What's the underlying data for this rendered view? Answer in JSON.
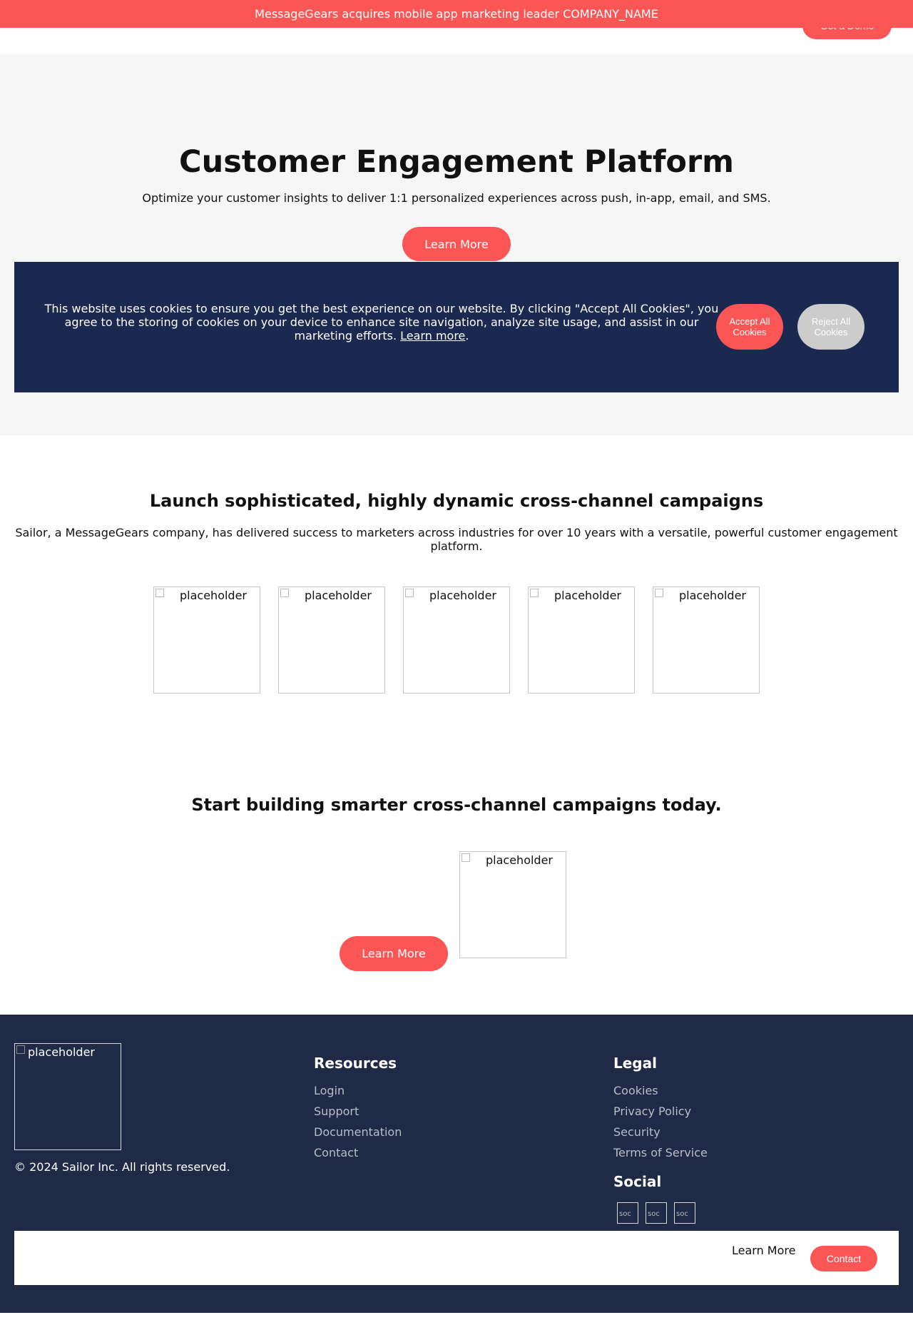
{
  "announcement": {
    "text": "MessageGears acquires mobile app marketing leader COMPANY_NAME"
  },
  "header": {
    "demo_button": "Get a Demo"
  },
  "hero": {
    "title": "Customer Engagement Platform",
    "subtitle": "Optimize your customer insights to deliver 1:1 personalized experiences across push, in-app, email, and SMS.",
    "cta": "Learn More"
  },
  "cookie_banner": {
    "text": "This website uses cookies to ensure you get the best experience on our website. By clicking \"Accept All Cookies\", you agree to the storing of cookies on your device to enhance site navigation, analyze site usage, and assist in our marketing efforts.",
    "link": "Learn more",
    "accept": "Accept All Cookies",
    "reject": "Reject All Cookies"
  },
  "campaigns": {
    "title": "Launch sophisticated, highly dynamic cross-channel campaigns",
    "subtitle": "Sailor, a MessageGears company, has delivered success to marketers across industries for over 10 years with a versatile, powerful customer engagement platform.",
    "logos": [
      "placeholder",
      "placeholder",
      "placeholder",
      "placeholder",
      "placeholder"
    ]
  },
  "cta_section": {
    "title": "Start building smarter cross-channel campaigns today.",
    "button": "Learn More",
    "image_alt": "placeholder"
  },
  "footer": {
    "logo_alt": "placeholder",
    "copyright": "© 2024 Sailor Inc. All rights reserved.",
    "resources": {
      "heading": "Resources",
      "links": [
        "Login",
        "Support",
        "Documentation",
        "Contact"
      ]
    },
    "legal": {
      "heading": "Legal",
      "links": [
        "Cookies",
        "Privacy Policy",
        "Security",
        "Terms of Service"
      ]
    },
    "social": {
      "heading": "Social",
      "icon_alts": [
        "soc",
        "soc",
        "soc"
      ]
    },
    "bottom_bar": {
      "learn_more": "Learn More",
      "contact": "Contact"
    }
  },
  "colors": {
    "accent": "#fc5555",
    "cookie_bg": "#1b2951",
    "footer_bg": "#1f2a47",
    "hero_bg": "#f6f6f6",
    "reject_bg": "#cccccc"
  }
}
